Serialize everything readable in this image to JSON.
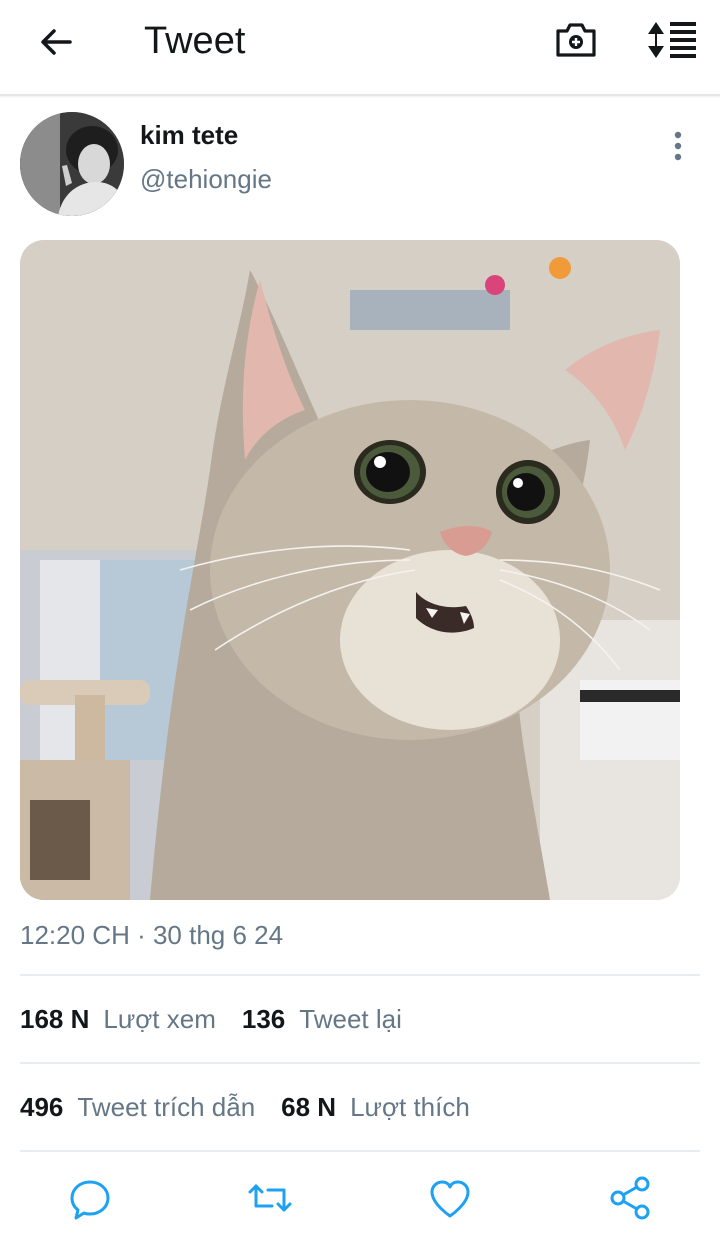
{
  "header": {
    "title": "Tweet",
    "back_icon": "arrow-left-icon",
    "camera_icon": "camera-plus-icon",
    "sort_icon": "sort-list-icon"
  },
  "tweet": {
    "author_name": "kim tete",
    "author_handle": "@tehiongie",
    "timestamp": "12:20 CH · 30 thg 6 24",
    "media_description_icon": "cat-photo"
  },
  "stats": {
    "views_count": "168 N",
    "views_label": "Lượt xem",
    "retweets_count": "136",
    "retweets_label": "Tweet lại",
    "quotes_count": "496",
    "quotes_label": "Tweet trích dẫn",
    "likes_count": "68 N",
    "likes_label": "Lượt thích"
  },
  "actions": [
    "reply-icon",
    "retweet-icon",
    "like-icon",
    "share-icon"
  ],
  "colors": {
    "text": "#14171a",
    "muted": "#657786",
    "icon": "#1da1f2"
  }
}
